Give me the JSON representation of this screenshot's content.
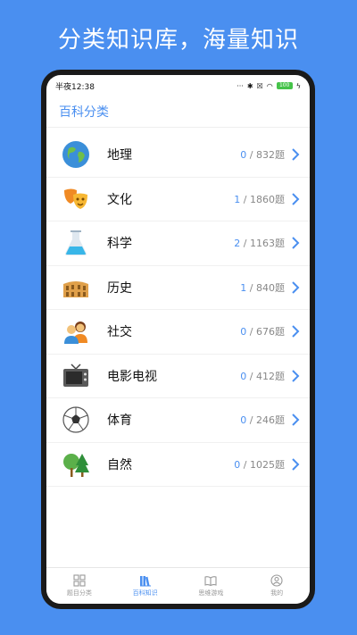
{
  "promo": {
    "title": "分类知识库，海量知识"
  },
  "status": {
    "time": "半夜12:38",
    "battery": "100"
  },
  "header": {
    "title": "百科分类"
  },
  "categories": [
    {
      "label": "地理",
      "done": "0",
      "total": " / 832题",
      "icon": "globe-icon"
    },
    {
      "label": "文化",
      "done": "1",
      "total": " / 1860题",
      "icon": "theater-masks-icon"
    },
    {
      "label": "科学",
      "done": "2",
      "total": " / 1163题",
      "icon": "flask-icon"
    },
    {
      "label": "历史",
      "done": "1",
      "total": " / 840题",
      "icon": "colosseum-icon"
    },
    {
      "label": "社交",
      "done": "0",
      "total": " / 676题",
      "icon": "people-icon"
    },
    {
      "label": "电影电视",
      "done": "0",
      "total": " / 412题",
      "icon": "television-icon"
    },
    {
      "label": "体育",
      "done": "0",
      "total": " / 246题",
      "icon": "soccer-ball-icon"
    },
    {
      "label": "自然",
      "done": "0",
      "total": " / 1025题",
      "icon": "trees-icon"
    }
  ],
  "tabs": [
    {
      "label": "题目分类",
      "icon": "grid-icon",
      "active": false
    },
    {
      "label": "百科知识",
      "icon": "books-icon",
      "active": true
    },
    {
      "label": "思维游戏",
      "icon": "open-book-icon",
      "active": false
    },
    {
      "label": "我的",
      "icon": "user-icon",
      "active": false
    }
  ],
  "colors": {
    "accent": "#4a8ff0",
    "background": "#4a8ff0"
  }
}
